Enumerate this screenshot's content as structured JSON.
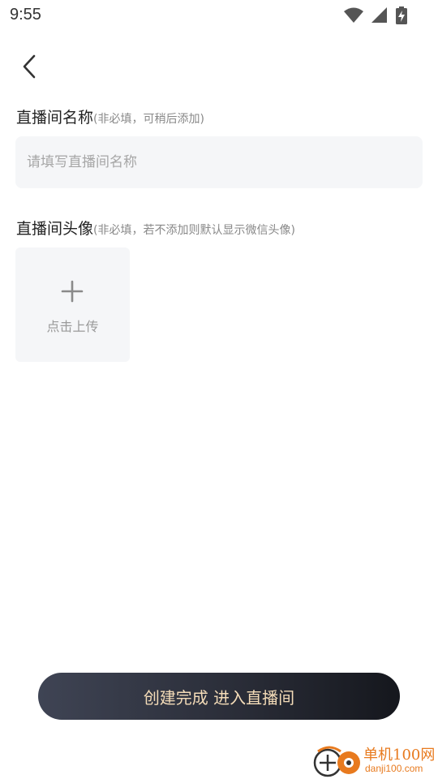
{
  "status_bar": {
    "time": "9:55",
    "icons": [
      "wifi-icon",
      "signal-icon",
      "battery-charging-icon"
    ]
  },
  "nav": {
    "back_icon": "chevron-left-icon"
  },
  "room_name": {
    "title": "直播间名称",
    "hint": "(非必填，可稍后添加)",
    "placeholder": "请填写直播间名称",
    "value": ""
  },
  "room_avatar": {
    "title": "直播间头像",
    "hint": "(非必填，若不添加则默认显示微信头像)",
    "upload_icon": "plus-icon",
    "upload_label": "点击上传"
  },
  "actions": {
    "create_label": "创建完成 进入直播间"
  },
  "watermark": {
    "name": "单机100网",
    "domain": "danji100.com"
  },
  "colors": {
    "button_text": "#f4dcb8",
    "button_bg_start": "#3f4454",
    "button_bg_end": "#15171d",
    "field_bg": "#f5f6f8",
    "watermark": "#e87a1e"
  }
}
